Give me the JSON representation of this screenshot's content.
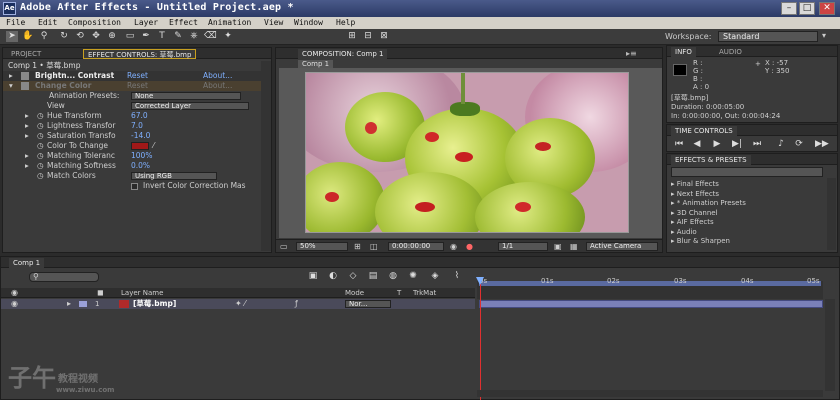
{
  "app": {
    "title": "Adobe After Effects - Untitled Project.aep *",
    "icon_label": "Ae"
  },
  "menu": [
    "File",
    "Edit",
    "Composition",
    "Layer",
    "Effect",
    "Animation",
    "View",
    "Window",
    "Help"
  ],
  "workspace": {
    "label": "Workspace:",
    "value": "Standard"
  },
  "project_panel": {
    "tab_label": "PROJECT"
  },
  "effect_controls": {
    "tab_label": "EFFECT CONTROLS: 草莓.bmp",
    "breadcrumb": "Comp 1 • 草莓.bmp",
    "effects": [
      {
        "name": "Brightn... Contrast",
        "reset": "Reset",
        "about": "About..."
      },
      {
        "name": "Change Color",
        "reset": "Reset",
        "about": "About..."
      }
    ],
    "animation_presets": {
      "label": "Animation Presets:",
      "value": "None"
    },
    "properties": [
      {
        "label": "View",
        "value": "Corrected Layer",
        "kind": "dropdown"
      },
      {
        "label": "Hue Transform",
        "value": "67.0",
        "kind": "number"
      },
      {
        "label": "Lightness Transfor",
        "value": "7.0",
        "kind": "number"
      },
      {
        "label": "Saturation Transfo",
        "value": "-14.0",
        "kind": "number"
      },
      {
        "label": "Color To Change",
        "value": "",
        "kind": "color"
      },
      {
        "label": "Matching Toleranc",
        "value": "100%",
        "kind": "number"
      },
      {
        "label": "Matching Softness",
        "value": "0.0%",
        "kind": "number"
      },
      {
        "label": "Match Colors",
        "value": "Using RGB",
        "kind": "dropdown"
      },
      {
        "label": "",
        "value": "Invert Color Correction Mas",
        "kind": "checkbox"
      }
    ],
    "color_to_change_hex": "#a01818"
  },
  "composition": {
    "tab_label": "COMPOSITION: Comp 1",
    "sub_tab": "Comp 1",
    "zoom": "50%",
    "timecode": "0:00:00:00",
    "resolution": "1/1",
    "camera": "Active Camera"
  },
  "info_panel": {
    "tab_info": "INFO",
    "tab_audio": "AUDIO",
    "r": "R :",
    "g": "G :",
    "b": "B :",
    "a": "A : 0",
    "x": "X : -57",
    "y": "Y : 350",
    "file": "[草莓.bmp]",
    "duration": "Duration: 0:00:05:00",
    "in_out": "In: 0:00:00:00, Out: 0:00:04:24"
  },
  "time_controls": {
    "tab_label": "TIME CONTROLS"
  },
  "effects_presets": {
    "tab_label": "EFFECTS & PRESETS",
    "items": [
      "Final Effects",
      "Next Effects",
      "* Animation Presets",
      "3D Channel",
      "AIF Effects",
      "Audio",
      "Blur & Sharpen"
    ]
  },
  "timeline": {
    "tab_label": "Comp 1",
    "columns": {
      "layer_name": "Layer Name",
      "mode": "Mode",
      "t": "T",
      "trkmat": "TrkMat"
    },
    "layers": [
      {
        "index": "1",
        "name": "[草莓.bmp]",
        "mode": "Nor..."
      }
    ],
    "ruler": [
      "0s",
      "01s",
      "02s",
      "03s",
      "04s",
      "05s"
    ]
  },
  "watermark": {
    "main": "子午",
    "sub": "教程视频",
    "url": "www.ziwu.com"
  }
}
